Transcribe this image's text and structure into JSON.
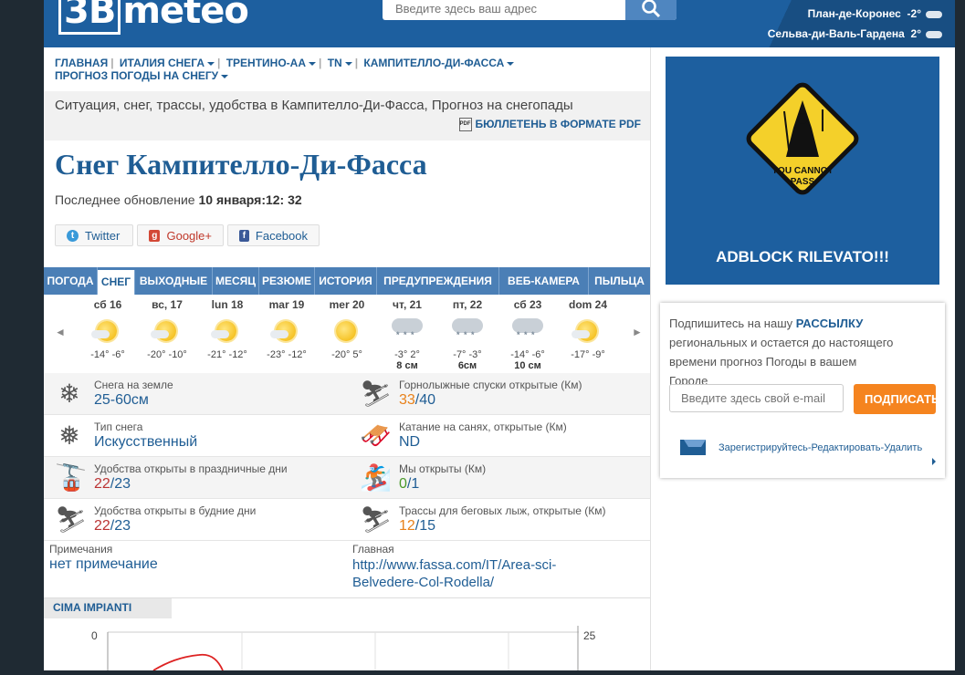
{
  "header": {
    "logo_mark": "3B",
    "logo_text": "meteo",
    "search_placeholder": "Введите здесь ваш адрес",
    "cities": [
      {
        "name": "План-де-Коронес",
        "temp": "-2°"
      },
      {
        "name": "Сельва-ди-Валь-Гардена",
        "temp": "2°"
      }
    ]
  },
  "nav": {
    "items": [
      "ГЛАВНАЯ",
      "ИТАЛИЯ СНЕГА",
      "ТРЕНТИНО-АА",
      "TN",
      "КАМПИТЕЛЛО-ДИ-ФАССА"
    ],
    "second_line": "ПРОГНОЗ ПОГОДЫ НА СНЕГУ"
  },
  "infobar": {
    "title": "Ситуация, снег, трассы, удобства в Кампителло-Ди-Фасса, Прогноз на снегопады",
    "pdf_label": "БЮЛЛЕТЕНЬ В ФОРМАТЕ PDF",
    "pdf_icon": "PDF"
  },
  "page_title": "Снег Кампителло-Ди-Фасса",
  "updated": {
    "label": "Последнее обновление",
    "value": "10 января:12: 32"
  },
  "social": {
    "twitter": "Twitter",
    "google": "Google+",
    "facebook": "Facebook"
  },
  "tabs": [
    "ПОГОДА",
    "СНЕГ",
    "ВЫХОДНЫЕ",
    "МЕСЯЦ",
    "РЕЗЮМЕ",
    "ИСТОРИЯ",
    "ПРЕДУПРЕЖДЕНИЯ",
    "ВЕБ-КАМЕРА",
    "ПЫЛЬЦА"
  ],
  "forecast": {
    "prev": "◄",
    "next": "►",
    "days": [
      {
        "label": "сб 16",
        "temp": "-14° -6°",
        "snow": "",
        "icon": "sun-icon"
      },
      {
        "label": "вс, 17",
        "temp": "-20° -10°",
        "snow": "",
        "icon": "sun-icon"
      },
      {
        "label": "lun 18",
        "temp": "-21° -12°",
        "snow": "",
        "icon": "sun-icon"
      },
      {
        "label": "mar 19",
        "temp": "-23° -12°",
        "snow": "",
        "icon": "sun-icon"
      },
      {
        "label": "mer 20",
        "temp": "-20° 5°",
        "snow": "",
        "icon": "sun-icon"
      },
      {
        "label": "чт, 21",
        "temp": "-3° 2°",
        "snow": "8 см",
        "icon": "snow-cloud-icon"
      },
      {
        "label": "пт, 22",
        "temp": "-7° -3°",
        "snow": "6см",
        "icon": "snow-cloud-icon"
      },
      {
        "label": "сб 23",
        "temp": "-14° -6°",
        "snow": "10 см",
        "icon": "snow-cloud-icon"
      },
      {
        "label": "dom 24",
        "temp": "-17° -9°",
        "snow": "",
        "icon": "sun-icon"
      }
    ]
  },
  "stats": {
    "snow_ground": {
      "label": "Снега на земле",
      "value": "25-60см"
    },
    "slopes_open": {
      "label": "Горнолыжные спуски открытые (Км)",
      "open": "33",
      "total": "/40"
    },
    "snow_type": {
      "label": "Тип снега",
      "value": "Искусственный"
    },
    "sledding": {
      "label": "Катание на санях, открытые (Км)",
      "value": "ND"
    },
    "lifts_holiday": {
      "label": "Удобства открыты в праздничные дни",
      "open": "22",
      "total": "/23"
    },
    "parks_open": {
      "label": "Мы открыты (Км)",
      "open": "0",
      "total": "/1"
    },
    "lifts_weekday": {
      "label": "Удобства открыты в будние дни",
      "open": "22",
      "total": "/23"
    },
    "crosscountry": {
      "label": "Трассы для беговых лыж, открытые (Км)",
      "open": "12",
      "total": "/15"
    }
  },
  "notes": {
    "label": "Примечания",
    "value": "нет примечание",
    "home_label": "Главная",
    "home_url": "http://www.fassa.com/IT/Area-sci-Belvedere-Col-Rodella/"
  },
  "cima": {
    "title": "CIMA IMPIANTI",
    "axis_left": "0",
    "axis_right": "25"
  },
  "ad": {
    "sign_line1": "YOU CANNOT",
    "sign_line2": "PASS",
    "text": "ADBLOCK RILEVATO!!!"
  },
  "newsletter": {
    "text_before": "Подпишитесь на нашу",
    "text_bold": "РАССЫЛКУ",
    "text_after": "региональных и остается до настоящего времени прогноз Погоды в вашем Городе",
    "email_placeholder": "Введите здесь свой e-mail",
    "subscribe": "ПОДПИСАТЬСЯ",
    "register": "Зарегистрируйтесь",
    "edit": "Редактировать",
    "remove": "Удалить",
    "sep": " - "
  }
}
